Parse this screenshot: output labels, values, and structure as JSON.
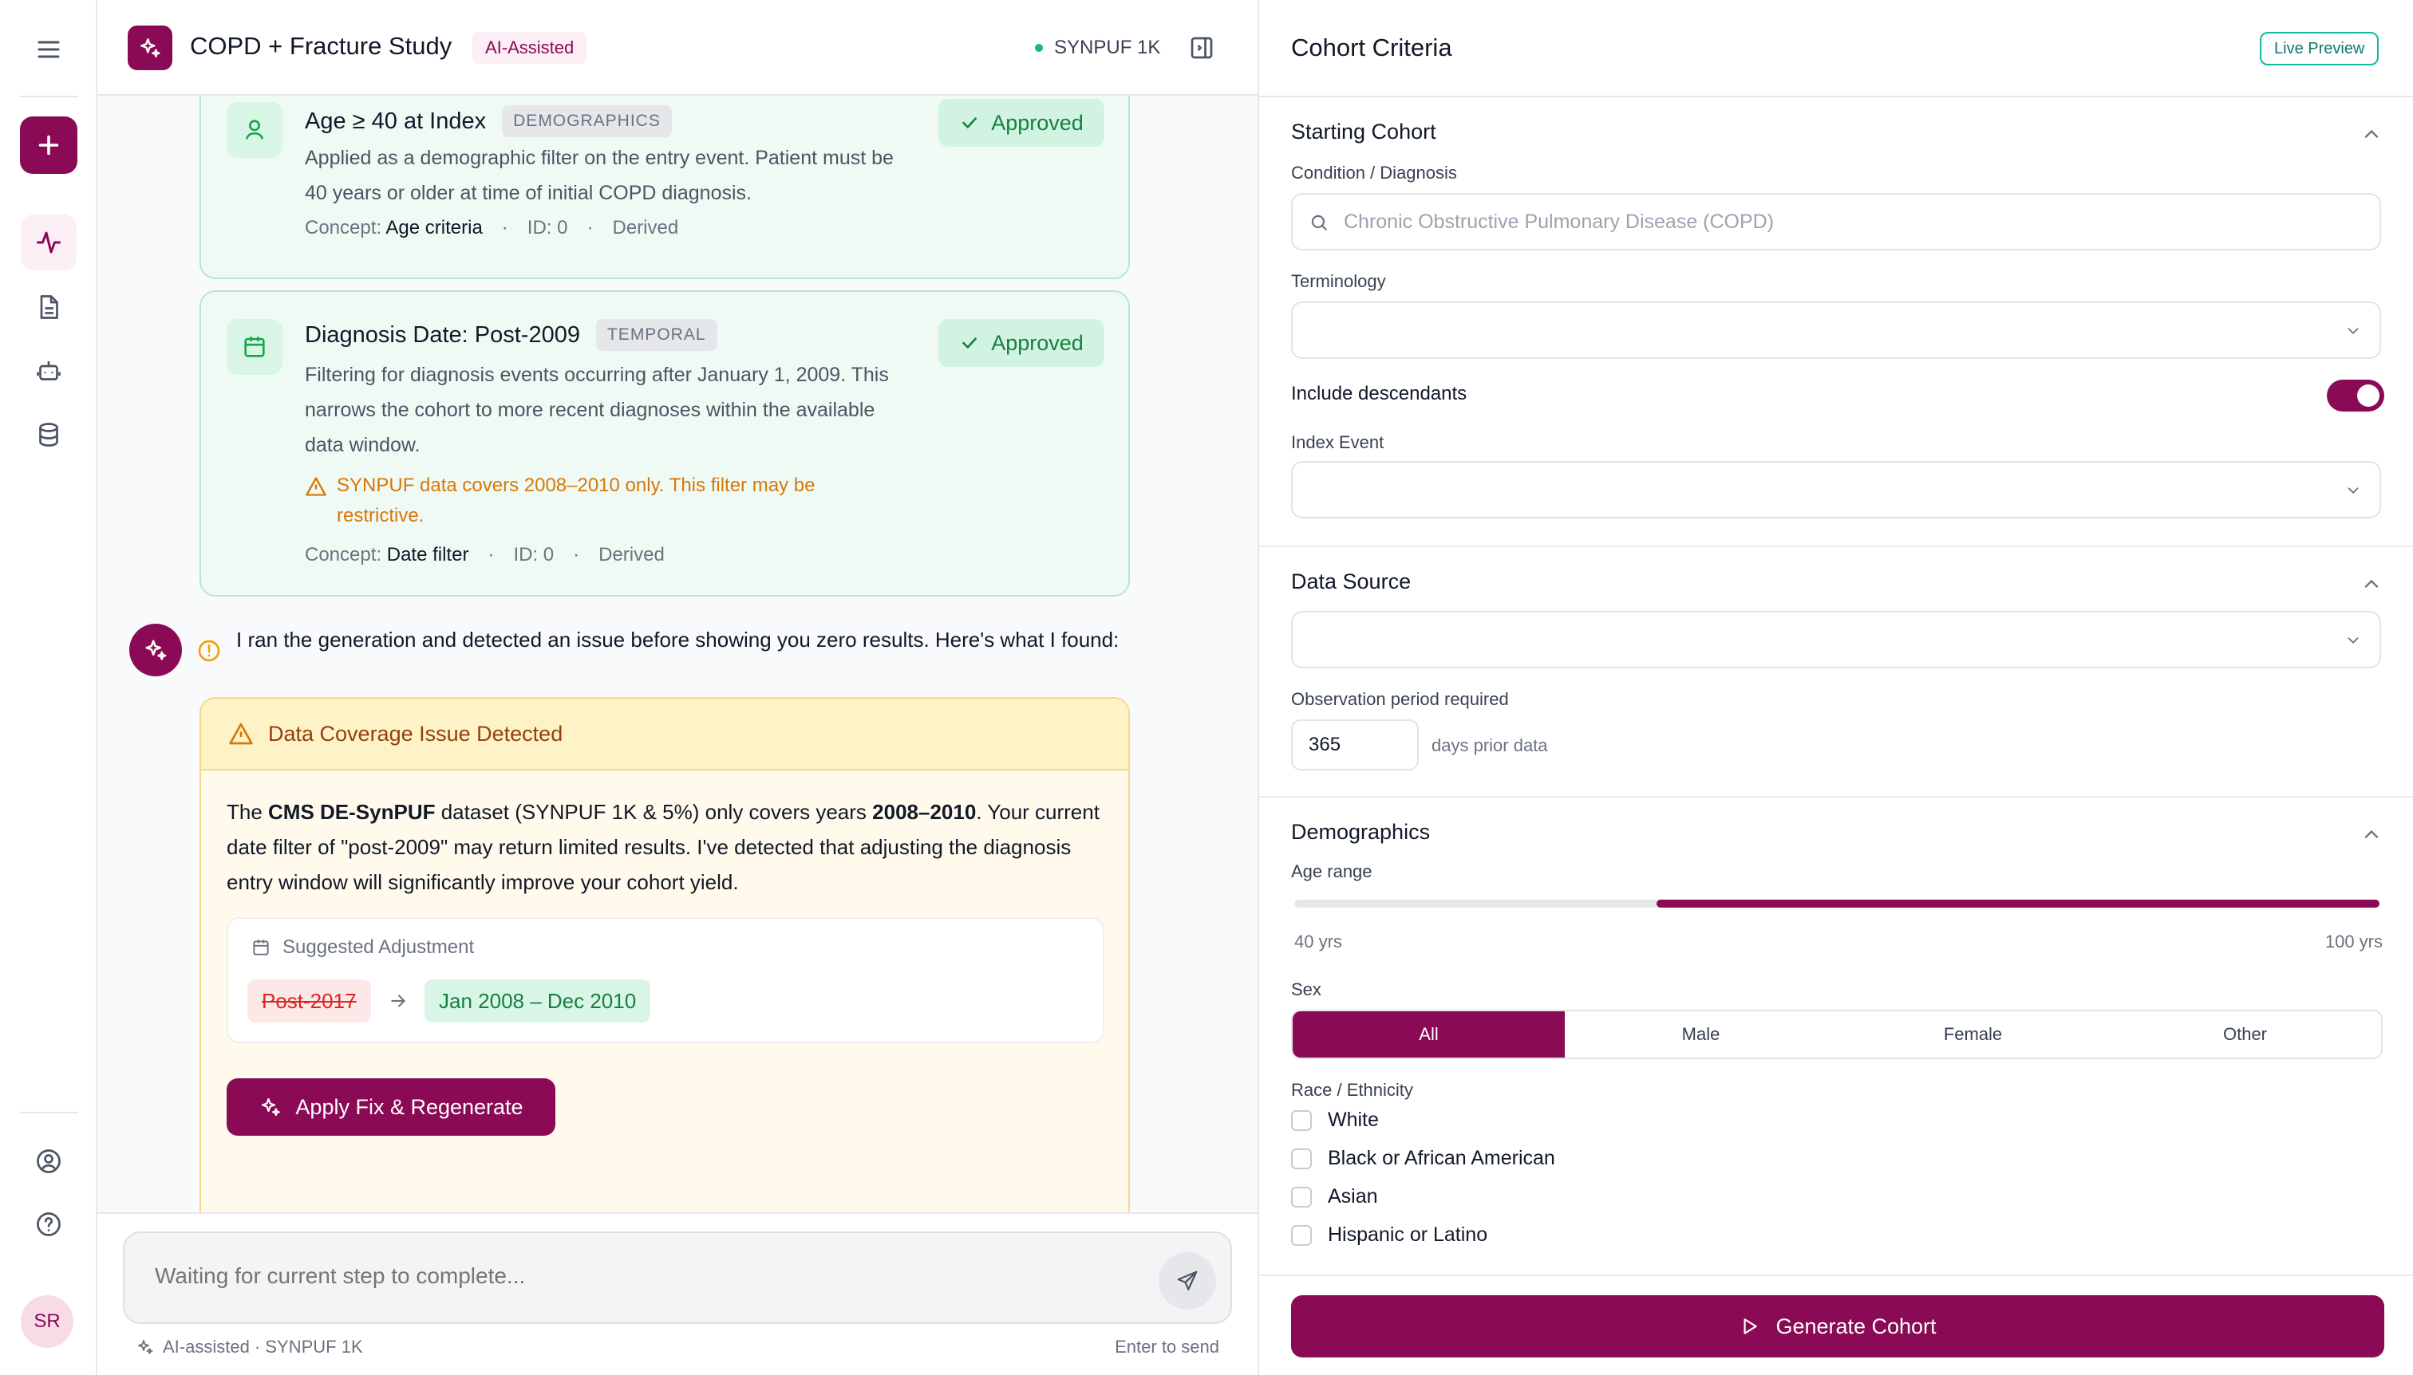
{
  "header": {
    "title": "COPD + Fracture Study",
    "badge": "AI-Assisted",
    "status": "SYNPUF 1K"
  },
  "cards": [
    {
      "title": "Age ≥ 40 at Index",
      "tag": "DEMOGRAPHICS",
      "status": "Approved",
      "description": "Applied as a demographic filter on the entry event. Patient must be 40 years or older at time of initial COPD diagnosis.",
      "concept_label": "Concept:",
      "concept_value": "Age criteria",
      "id": "ID: 0",
      "derived": "Derived"
    },
    {
      "title": "Diagnosis Date: Post-2009",
      "tag": "TEMPORAL",
      "status": "Approved",
      "description": "Filtering for diagnosis events occurring after January 1, 2009. This narrows the cohort to more recent diagnoses within the available data window.",
      "warning": "SYNPUF data covers 2008–2010 only. This filter may be restrictive.",
      "concept_label": "Concept:",
      "concept_value": "Date filter",
      "id": "ID: 0",
      "derived": "Derived"
    }
  ],
  "ai_message": "I ran the generation and detected an issue before showing you zero results. Here's what I found:",
  "issue": {
    "title": "Data Coverage Issue Detected",
    "body_1": "The ",
    "body_b1": "CMS DE-SynPUF",
    "body_2": " dataset (SYNPUF 1K & 5%) only covers years ",
    "body_b2": "2008–2010",
    "body_3": ". Your current date filter of \"post-2009\" may return limited results. I've detected that adjusting the diagnosis entry window will significantly improve your cohort yield.",
    "suggestion_title": "Suggested Adjustment",
    "old_value": "Post-2017",
    "new_value": "Jan 2008 – Dec 2010",
    "apply_label": "Apply Fix & Regenerate"
  },
  "input": {
    "placeholder": "Waiting for current step to complete...",
    "footer_left": "AI-assisted · SYNPUF 1K",
    "footer_right": "Enter to send"
  },
  "right": {
    "title": "Cohort Criteria",
    "live_badge": "Live Preview",
    "starting": {
      "title": "Starting Cohort",
      "condition_label": "Condition / Diagnosis",
      "condition_placeholder": "Chronic Obstructive Pulmonary Disease (COPD)",
      "terminology_label": "Terminology",
      "descendants_label": "Include descendants",
      "index_label": "Index Event"
    },
    "datasource": {
      "title": "Data Source",
      "obs_label": "Observation period required",
      "obs_value": "365",
      "obs_unit": "days prior data"
    },
    "demographics": {
      "title": "Demographics",
      "age_label": "Age range",
      "age_min": "40 yrs",
      "age_max": "100 yrs",
      "sex_label": "Sex",
      "sex_options": [
        "All",
        "Male",
        "Female",
        "Other"
      ],
      "race_label": "Race / Ethnicity",
      "race_options": [
        "White",
        "Black or African American",
        "Asian",
        "Hispanic or Latino"
      ]
    },
    "generate_label": "Generate Cohort"
  },
  "user": {
    "initials": "SR"
  },
  "colors": {
    "accent": "#8b0a55",
    "success": "#15803d",
    "warning": "#d97706"
  }
}
